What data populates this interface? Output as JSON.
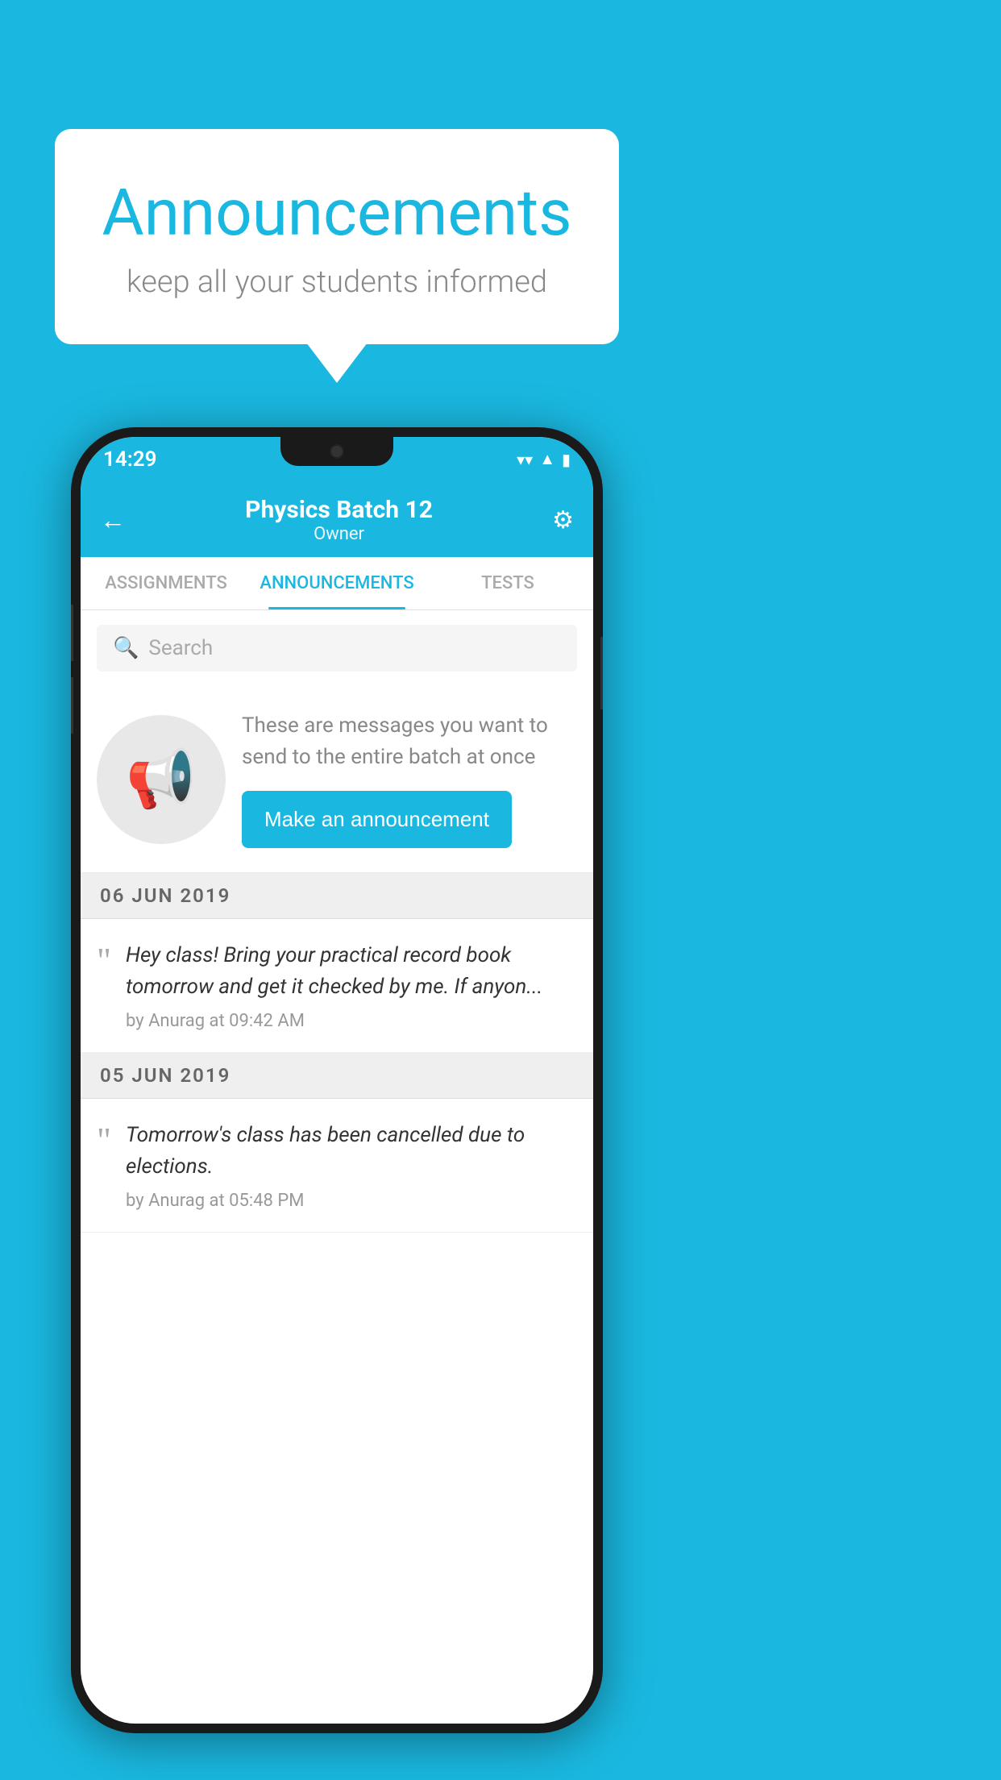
{
  "page": {
    "background_color": "#1ab8e0"
  },
  "speech_bubble": {
    "title": "Announcements",
    "subtitle": "keep all your students informed"
  },
  "phone": {
    "status_bar": {
      "time": "14:29"
    },
    "header": {
      "title": "Physics Batch 12",
      "subtitle": "Owner",
      "back_label": "←",
      "gear_label": "⚙"
    },
    "tabs": [
      {
        "label": "ASSIGNMENTS",
        "active": false
      },
      {
        "label": "ANNOUNCEMENTS",
        "active": true
      },
      {
        "label": "TESTS",
        "active": false
      }
    ],
    "search": {
      "placeholder": "Search"
    },
    "promo": {
      "description": "These are messages you want to send to the entire batch at once",
      "button_label": "Make an announcement"
    },
    "announcements": [
      {
        "date": "06  JUN  2019",
        "message": "Hey class! Bring your practical record book tomorrow and get it checked by me. If anyon...",
        "meta": "by Anurag at 09:42 AM"
      },
      {
        "date": "05  JUN  2019",
        "message": "Tomorrow's class has been cancelled due to elections.",
        "meta": "by Anurag at 05:48 PM"
      }
    ]
  }
}
